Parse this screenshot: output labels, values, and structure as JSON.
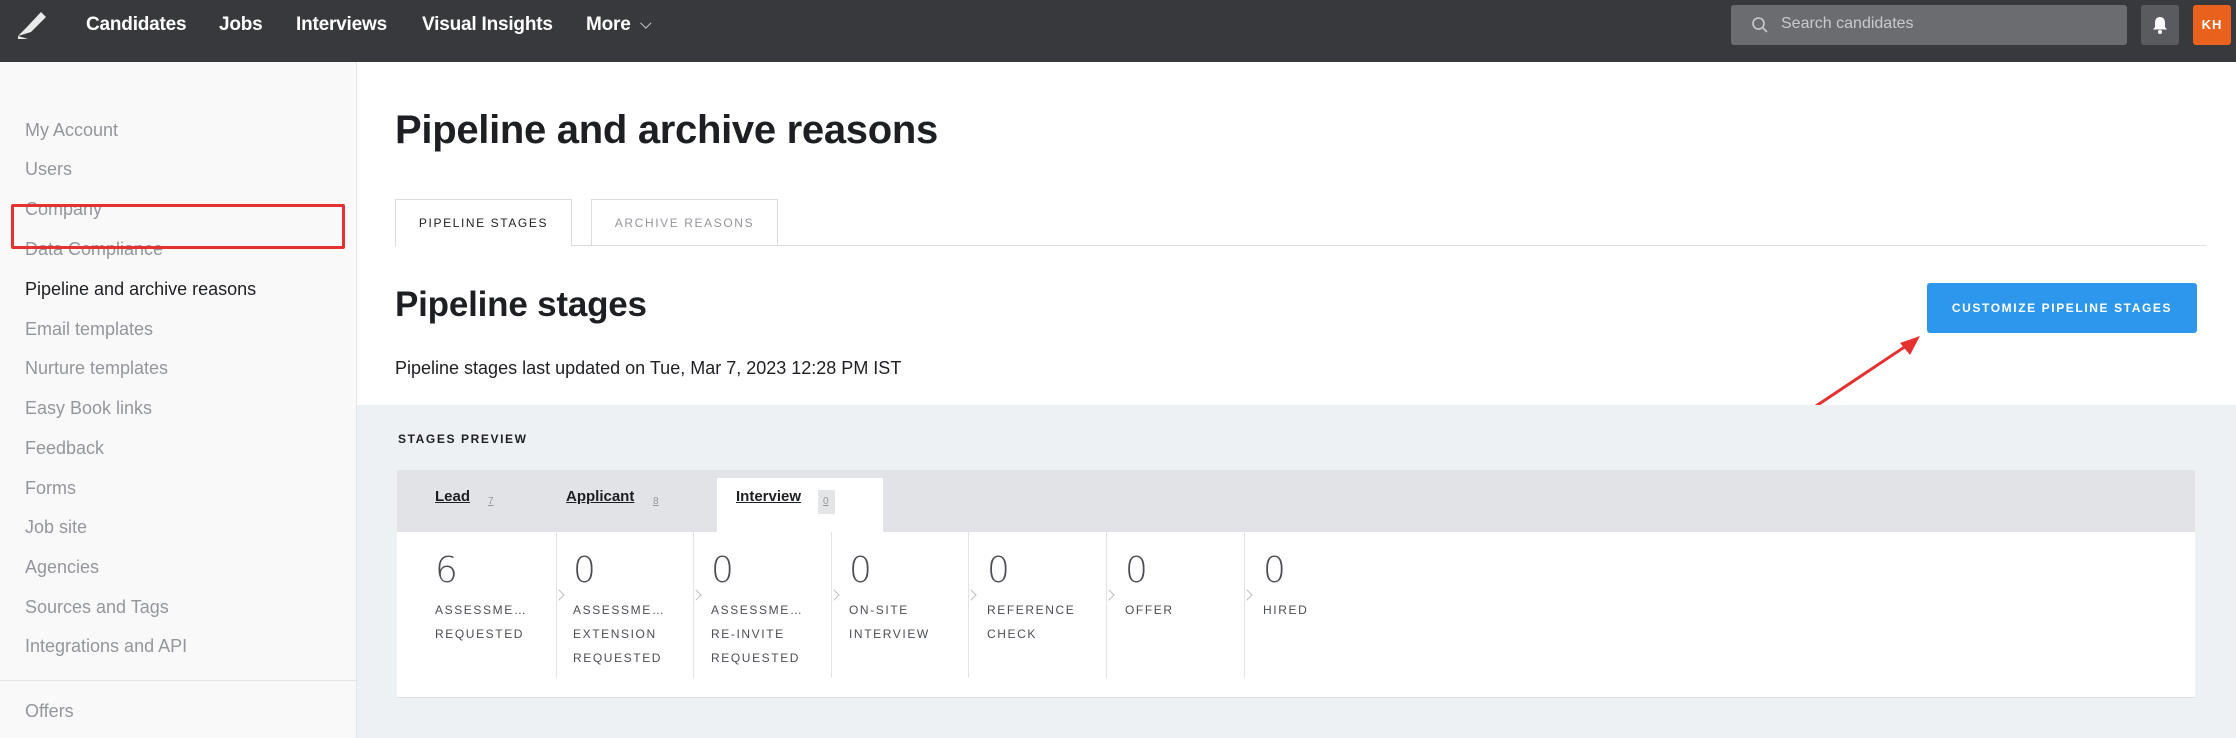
{
  "nav": {
    "items": [
      {
        "label": "Candidates"
      },
      {
        "label": "Jobs"
      },
      {
        "label": "Interviews"
      },
      {
        "label": "Visual Insights"
      },
      {
        "label": "More"
      }
    ],
    "search_placeholder": "Search candidates",
    "avatar_initials": "KH"
  },
  "sidebar": {
    "items": [
      {
        "label": "My Account"
      },
      {
        "label": "Users"
      },
      {
        "label": "Company"
      },
      {
        "label": "Data Compliance"
      },
      {
        "label": "Pipeline and archive reasons"
      },
      {
        "label": "Email templates"
      },
      {
        "label": "Nurture templates"
      },
      {
        "label": "Easy Book links"
      },
      {
        "label": "Feedback"
      },
      {
        "label": "Forms"
      },
      {
        "label": "Job site"
      },
      {
        "label": "Agencies"
      },
      {
        "label": "Sources and Tags"
      },
      {
        "label": "Integrations and API"
      },
      {
        "label": "Offers"
      }
    ],
    "active_index": 4
  },
  "main": {
    "title": "Pipeline and archive reasons",
    "tabs": [
      {
        "label": "PIPELINE STAGES",
        "active": true
      },
      {
        "label": "ARCHIVE REASONS",
        "active": false
      }
    ],
    "section_title": "Pipeline stages",
    "cta_label": "CUSTOMIZE PIPELINE STAGES",
    "updated_text": "Pipeline stages last updated on Tue, Mar 7, 2023 12:28 PM IST",
    "preview": {
      "label": "STAGES PREVIEW",
      "tabs": [
        {
          "label": "Lead",
          "count": "7"
        },
        {
          "label": "Applicant",
          "count": "8"
        },
        {
          "label": "Interview",
          "count": "0"
        }
      ],
      "stages": [
        {
          "count": "6",
          "line1": "ASSESSME…",
          "line2": "REQUESTED",
          "line3": ""
        },
        {
          "count": "0",
          "line1": "ASSESSME…",
          "line2": "EXTENSION",
          "line3": "REQUESTED"
        },
        {
          "count": "0",
          "line1": "ASSESSME…",
          "line2": "RE-INVITE",
          "line3": "REQUESTED"
        },
        {
          "count": "0",
          "line1": "ON-SITE",
          "line2": "INTERVIEW",
          "line3": ""
        },
        {
          "count": "0",
          "line1": "REFERENCE",
          "line2": "CHECK",
          "line3": ""
        },
        {
          "count": "0",
          "line1": "OFFER",
          "line2": "",
          "line3": ""
        },
        {
          "count": "0",
          "line1": "HIRED",
          "line2": "",
          "line3": ""
        }
      ]
    }
  },
  "colors": {
    "nav_bg": "#38393d",
    "accent_blue": "#2d97ee",
    "highlight_red": "#e5312f",
    "avatar_orange": "#e8621d"
  }
}
